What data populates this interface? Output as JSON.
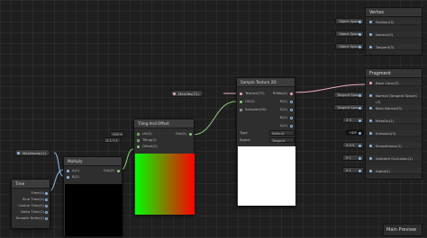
{
  "property_pills": [
    {
      "label": "MainTex(T2)"
    },
    {
      "label": "MainFactor(1)"
    }
  ],
  "time_node": {
    "title": "Time",
    "outputs": [
      "Time(1)",
      "Sine Time(1)",
      "Cosine Time(1)",
      "Delta Time(1)",
      "Smooth Delta(1)"
    ]
  },
  "multiply_node": {
    "title": "Multiply",
    "inputs": [
      "A(1)",
      "B(2)"
    ],
    "outputs": [
      "Out(2)"
    ]
  },
  "tiling_node": {
    "title": "Tiling And Offset",
    "inputs": [
      "UV(2)",
      "Tiling(2)",
      "Offset(2)"
    ],
    "outputs": [
      "Out(2)"
    ],
    "uv_channel": "UV0",
    "tiling_values": {
      "x_label": "X",
      "x": "1",
      "y_label": "Y",
      "y": "1"
    }
  },
  "sample_node": {
    "title": "Sample Texture 2D",
    "inputs": [
      "Texture(T2)",
      "UV(2)",
      "Sampler(SS)"
    ],
    "outputs": [
      "RGBA(4)",
      "R(1)",
      "G(1)",
      "B(1)",
      "A(1)"
    ],
    "type_label": "Type",
    "type_value": "Default",
    "space_label": "Space",
    "space_value": "Tangent"
  },
  "vertex_block": {
    "title": "Vertex",
    "rows": [
      "Position(3)",
      "Normal(3)",
      "Tangent(3)"
    ],
    "external_labels": [
      "Object Space",
      "Object Space",
      "Object Space"
    ]
  },
  "fragment_block": {
    "title": "Fragment",
    "rows": [
      "Base Color(3)",
      "Normal (Tangent Space)(3)",
      "Bent Normal(3)",
      "Metallic(1)",
      "Emission(3)",
      "Smoothness(1)",
      "Ambient Occlusion(1)",
      "Alpha(1)"
    ],
    "external_labels": [
      "",
      "Tangent Space",
      "Tangent Space",
      "X  0",
      "HDR",
      "X  0.5",
      "X  1",
      "X  1"
    ]
  },
  "main_preview": {
    "label": "Main Preview"
  },
  "colors": {
    "background": "#1f1f1f",
    "wire_vector2": "#8ad07a",
    "wire_vector4": "#f0a8c8",
    "wire_texture": "#f0a8c8",
    "wire_float": "#8fb9e6"
  }
}
